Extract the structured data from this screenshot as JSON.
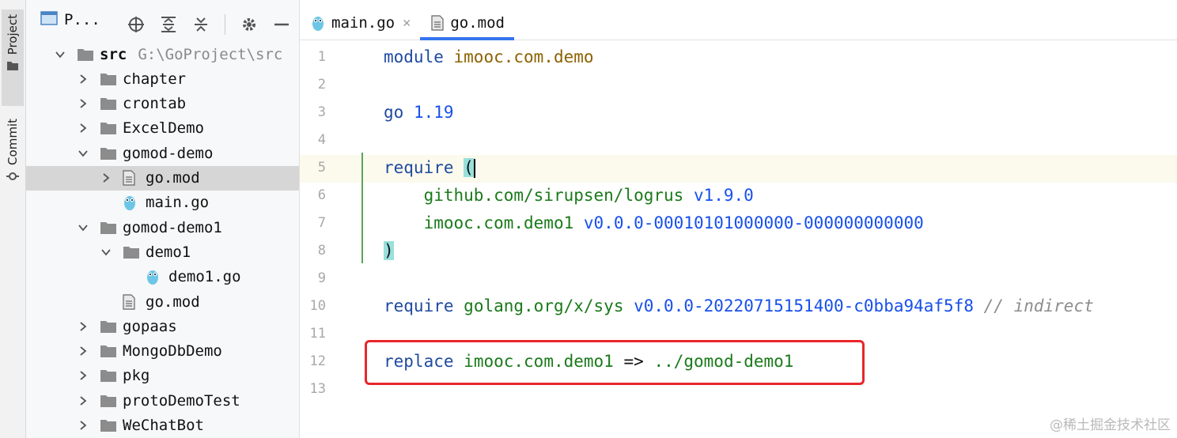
{
  "toolstrip": {
    "project_label": "Project",
    "commit_label": "Commit"
  },
  "project_panel": {
    "title": "P...",
    "header_icons": [
      "crosshair-icon",
      "expand-all-icon",
      "collapse-all-icon",
      "gear-icon",
      "minimize-icon"
    ]
  },
  "tree": [
    {
      "name": "src",
      "path": "G:\\GoProject\\src",
      "type": "folder",
      "expanded": true
    },
    {
      "name": "chapter",
      "type": "folder"
    },
    {
      "name": "crontab",
      "type": "folder"
    },
    {
      "name": "ExcelDemo",
      "type": "folder"
    },
    {
      "name": "gomod-demo",
      "type": "folder",
      "expanded": true
    },
    {
      "name": "go.mod",
      "type": "mod-file",
      "selected": true
    },
    {
      "name": "main.go",
      "type": "go-file"
    },
    {
      "name": "gomod-demo1",
      "type": "folder",
      "expanded": true
    },
    {
      "name": "demo1",
      "type": "folder",
      "expanded": true
    },
    {
      "name": "demo1.go",
      "type": "go-file"
    },
    {
      "name": "go.mod",
      "type": "mod-file"
    },
    {
      "name": "gopaas",
      "type": "folder"
    },
    {
      "name": "MongoDbDemo",
      "type": "folder"
    },
    {
      "name": "pkg",
      "type": "folder"
    },
    {
      "name": "protoDemoTest",
      "type": "folder"
    },
    {
      "name": "WeChatBot",
      "type": "folder"
    }
  ],
  "tabs": [
    {
      "label": "main.go",
      "icon": "gopher-icon",
      "active": false
    },
    {
      "label": "go.mod",
      "icon": "mod-file-icon",
      "active": true
    }
  ],
  "editor": {
    "line_numbers": [
      "1",
      "2",
      "3",
      "4",
      "5",
      "6",
      "7",
      "8",
      "9",
      "10",
      "11",
      "12",
      "13"
    ],
    "lines": {
      "l1_kw": "module",
      "l1_mod": "imooc.com.demo",
      "l3_kw": "go",
      "l3_num": "1.19",
      "l5_kw": "require",
      "l5_paren": "(",
      "l6_pkg": "github.com/sirupsen/logrus",
      "l6_ver": "v1.9.0",
      "l7_pkg": "imooc.com.demo1",
      "l7_ver": "v0.0.0-00010101000000-000000000000",
      "l8_paren": ")",
      "l10_kw": "require",
      "l10_pkg": "golang.org/x/sys",
      "l10_ver": "v0.0.0-20220715151400-c0bba94af5f8",
      "l10_cmt": "// indirect",
      "l12_kw": "replace",
      "l12_pkg": "imooc.com.demo1",
      "l12_arrow": "=>",
      "l12_path": "../gomod-demo1"
    }
  },
  "watermark": "@稀土掘金技术社区",
  "colors": {
    "keyword": "#1f4aa0",
    "module_name": "#8c6200",
    "package": "#1a7a1a",
    "version": "#1750eb",
    "highlight_box": "#e8262b",
    "tab_underline": "#3574f0"
  }
}
